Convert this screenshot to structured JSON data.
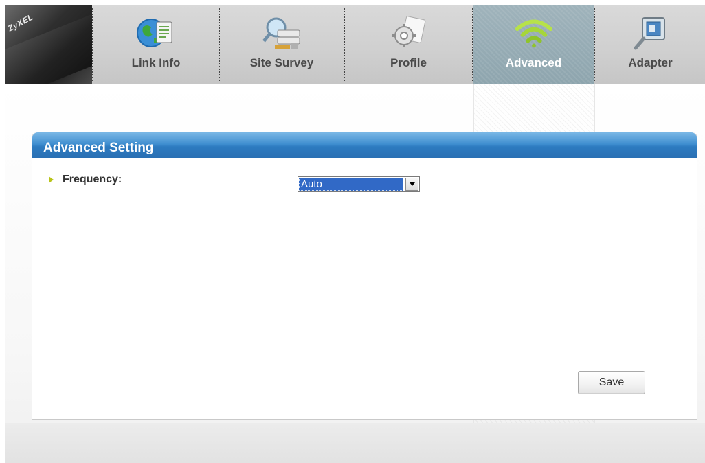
{
  "brand": "ZyXEL",
  "nav": {
    "tabs": [
      {
        "label": "Link Info",
        "icon": "globe-document-icon"
      },
      {
        "label": "Site Survey",
        "icon": "network-search-icon"
      },
      {
        "label": "Profile",
        "icon": "gear-document-icon"
      },
      {
        "label": "Advanced",
        "icon": "wireless-signal-icon",
        "active": true
      },
      {
        "label": "Adapter",
        "icon": "adapter-icon"
      }
    ]
  },
  "panel": {
    "title": "Advanced Setting",
    "frequency_label": "Frequency:",
    "frequency_value": "Auto",
    "save_label": "Save"
  },
  "colors": {
    "header_blue": "#3f8ed0",
    "active_tab": "#9fb3bb",
    "bullet_green": "#b9c41a",
    "select_highlight": "#3169c6"
  }
}
